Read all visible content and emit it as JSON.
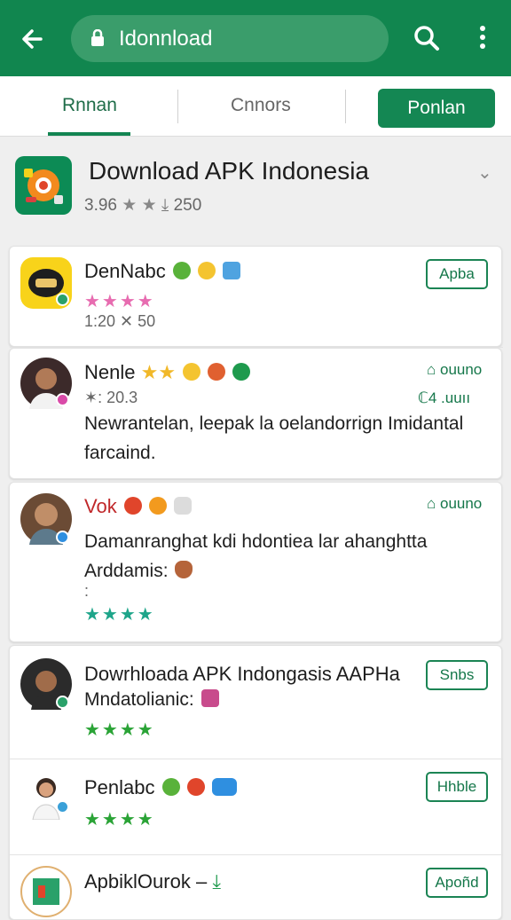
{
  "topbar": {
    "url": "Idonnload",
    "icons": [
      "back-arrow-icon",
      "lock-icon",
      "search-icon",
      "more-vert-icon"
    ],
    "color": "#11864f"
  },
  "tabs": {
    "tab1": "Rnnan",
    "tab2": "Cnnors",
    "tab3": "Ponlan"
  },
  "header": {
    "title": "Download APK Indonesia",
    "rating": "3.96",
    "count": "250"
  },
  "apps": [
    {
      "name": "DenNabc",
      "rating_text": "",
      "meta": "1:20  ✕ 50",
      "button": "Apba",
      "stars": "★★★★"
    },
    {
      "name": "Nenle",
      "meta": "✶: 20.3",
      "desc_line1": "Newrantelan, leepak  la oelandorrign Imidantal",
      "desc_line2": "farcaind.",
      "side1": "⌂ ouuno",
      "side2": "ℂ4 .uuıı"
    },
    {
      "name": "Vok",
      "desc_line1": "Damanranghat kdi hdontiea lar ahanghtta",
      "desc_line2": "Arddamis:",
      "extra": ":",
      "side1": "⌂ ouuno",
      "stars": "★★★★"
    },
    {
      "name": "Dowrhloada APK Indongasis AAPHa",
      "desc_line1": "Mndatolianic:",
      "button": "Snbs",
      "stars": "★★★★"
    },
    {
      "name": "Penlabc",
      "button": "Hhble",
      "stars": "★★★★"
    },
    {
      "name": "ApbiklOurok –",
      "button": "Apoñd"
    }
  ]
}
